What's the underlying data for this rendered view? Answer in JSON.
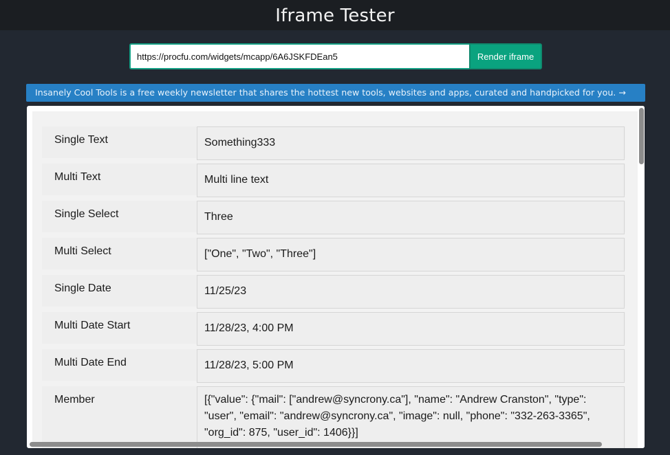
{
  "header": {
    "title": "Iframe Tester"
  },
  "toolbar": {
    "url_value": "https://procfu.com/widgets/mcapp/6A6JSKFDEan5",
    "render_label": "Render iframe"
  },
  "banner": {
    "text": "Insanely Cool Tools is a free weekly newsletter that shares the hottest new tools, websites and apps, curated and handpicked for you. →"
  },
  "fields": [
    {
      "label": "Single Text",
      "value": "Something333"
    },
    {
      "label": "Multi Text",
      "value": "Multi line text"
    },
    {
      "label": "Single Select",
      "value": "Three"
    },
    {
      "label": "Multi Select",
      "value": "[\"One\", \"Two\", \"Three\"]"
    },
    {
      "label": "Single Date",
      "value": "11/25/23"
    },
    {
      "label": "Multi Date Start",
      "value": "11/28/23, 4:00 PM"
    },
    {
      "label": "Multi Date End",
      "value": "11/28/23, 5:00 PM"
    },
    {
      "label": "Member",
      "value": "[{\"value\": {\"mail\": [\"andrew@syncrony.ca\"], \"name\": \"Andrew Cranston\", \"type\": \"user\", \"email\": \"andrew@syncrony.ca\", \"image\": null, \"phone\": \"332-263-3365\", \"org_id\": 875, \"user_id\": 1406}}]"
    }
  ],
  "colors": {
    "background": "#222831",
    "accent": "#0aa37f",
    "banner": "#2780c5"
  }
}
